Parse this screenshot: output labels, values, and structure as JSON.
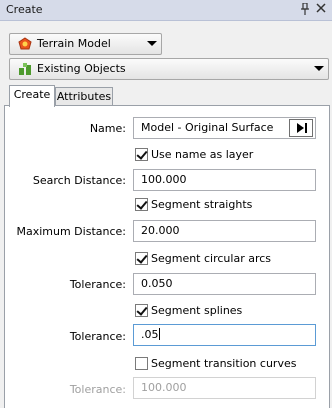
{
  "window": {
    "title": "Create"
  },
  "toolbar": {
    "terrain_model": "Terrain Model",
    "existing_objects": "Existing Objects"
  },
  "tabs": [
    "Create",
    "Attributes"
  ],
  "form": {
    "name_label": "Name:",
    "name_value": "Model - Original Surface",
    "use_name_as_layer": "Use name as layer",
    "search_distance_label": "Search Distance:",
    "search_distance_value": "100.000",
    "segment_straights": "Segment straights",
    "maximum_distance_label": "Maximum Distance:",
    "maximum_distance_value": "20.000",
    "segment_circular_arcs": "Segment circular arcs",
    "tolerance_label": "Tolerance:",
    "arc_tolerance_value": "0.050",
    "segment_splines": "Segment splines",
    "spline_tolerance_value": ".05",
    "segment_transition_curves": "Segment transition curves",
    "transition_tolerance_value": "100.000"
  },
  "checkbox_states": {
    "use_name_as_layer": true,
    "segment_straights": true,
    "segment_circular_arcs": true,
    "segment_splines": true,
    "segment_transition_curves": false
  },
  "colors": {
    "titlebar": "#d6dbe9",
    "panel": "#ffffff",
    "focus_border": "#5b9bd5",
    "terrain_icon": "#e8541e",
    "objects_icon": "#4e9a2e"
  }
}
